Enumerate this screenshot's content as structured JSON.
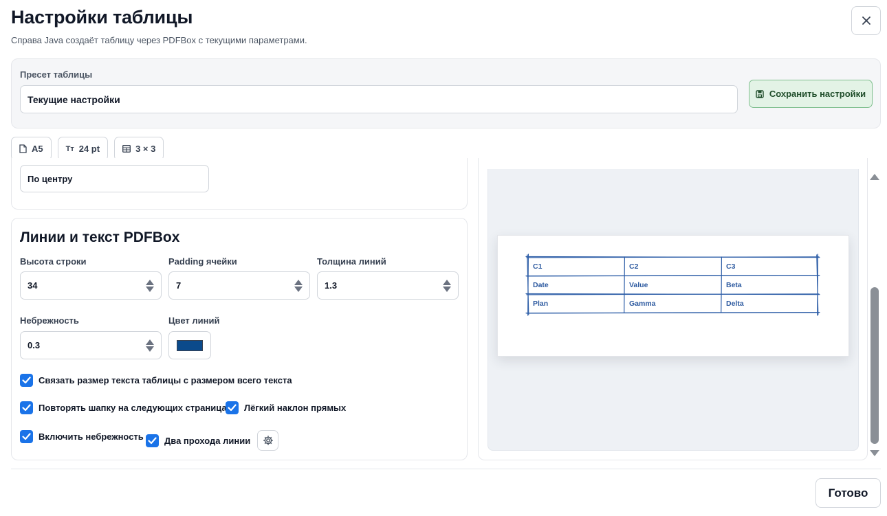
{
  "dialog": {
    "title": "Настройки таблицы",
    "subtitle": "Справа Java создаёт таблицу через PDFBox с текущими параметрами."
  },
  "preset": {
    "label": "Пресет таблицы",
    "value": "Текущие настройки",
    "save_label": "Сохранить настройки"
  },
  "chips": [
    {
      "icon": "page-icon",
      "label": "A5"
    },
    {
      "icon": "font-size-icon",
      "icon_text": "Tт",
      "label": "24 pt"
    },
    {
      "icon": "table-grid-icon",
      "label": "3 × 3"
    }
  ],
  "alignment": {
    "value": "По центру"
  },
  "lines": {
    "title": "Линии и текст PDFBox",
    "row_height": {
      "label": "Высота строки",
      "value": "34"
    },
    "cell_padding": {
      "label": "Padding ячейки",
      "value": "7"
    },
    "line_width": {
      "label": "Толщина линий",
      "value": "1.3"
    },
    "sloppiness": {
      "label": "Небрежность",
      "value": "0.3"
    },
    "line_color": {
      "label": "Цвет линий",
      "value": "#0b4a8b"
    },
    "checkboxes": {
      "link_text_size": {
        "label": "Связать размер текста таблицы с размером всего текста",
        "checked": true
      },
      "repeat_header": {
        "label": "Повторять шапку на следующих страницах",
        "checked": true
      },
      "slight_tilt": {
        "label": "Лёгкий наклон прямых",
        "checked": true
      },
      "enable_sloppiness": {
        "label": "Включить небрежность",
        "checked": true
      },
      "double_pass": {
        "label": "Два прохода линии",
        "checked": true
      }
    }
  },
  "preview": {
    "table": [
      [
        "C1",
        "C2",
        "C3"
      ],
      [
        "Date",
        "Value",
        "Beta"
      ],
      [
        "Plan",
        "Gamma",
        "Delta"
      ]
    ],
    "line_color": "#2f5fa8",
    "text_color": "#2d5aa0"
  },
  "footer": {
    "done_label": "Готово"
  },
  "colors": {
    "accent": "#1a73e8",
    "save_bg": "#e3f3e6",
    "save_border": "#7fbf8e"
  }
}
